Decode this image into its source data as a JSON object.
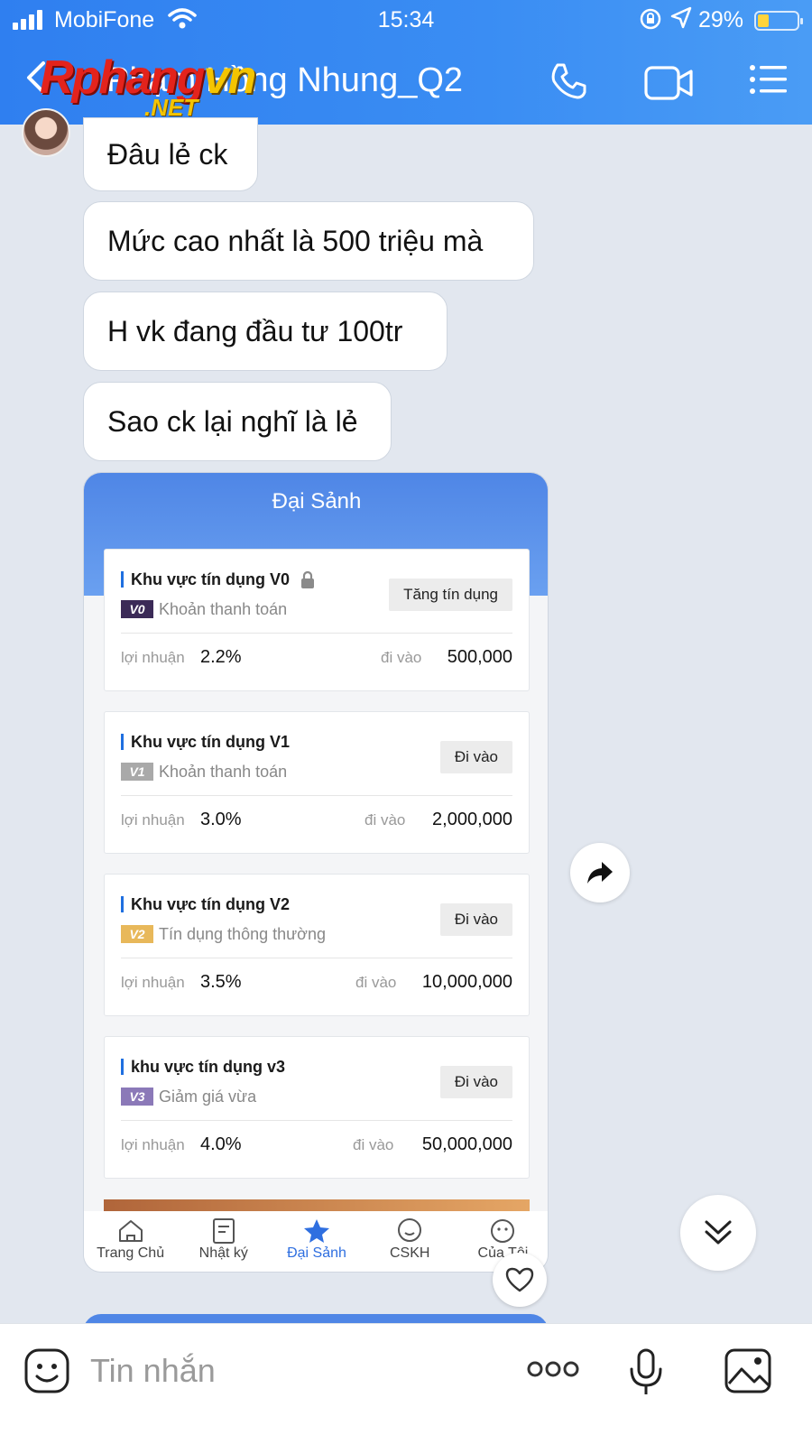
{
  "status_bar": {
    "carrier": "MobiFone",
    "time": "15:34",
    "battery": "29%"
  },
  "header": {
    "back_icon": "chevron-left-icon",
    "title": "Phạm Hồng Nhung_Q2",
    "icons": [
      "phone-icon",
      "video-icon",
      "menu-icon"
    ]
  },
  "watermark": {
    "main_red": "Rphang",
    "main_yellow": "vn",
    "sub": ".NET"
  },
  "messages": [
    {
      "text": "Đâu lẻ ck"
    },
    {
      "text": "Mức cao nhất là 500 triệu mà"
    },
    {
      "text": "H vk đang đầu tư 100tr"
    },
    {
      "text": "Sao ck lại nghĩ là lẻ"
    }
  ],
  "image_card": {
    "title": "Đại Sảnh",
    "zones": [
      {
        "name": "Khu vực tín dụng V0",
        "locked": true,
        "tag": "V0",
        "tag_color": "#3b2a57",
        "desc": "Khoản thanh toán",
        "button": "Tăng tín dụng",
        "profit_label": "lợi nhuận",
        "profit": "2.2%",
        "entry_label": "đi vào",
        "entry": "500,000"
      },
      {
        "name": "Khu vực tín dụng V1",
        "locked": false,
        "tag": "V1",
        "tag_color": "#a9a9a9",
        "desc": "Khoản thanh toán",
        "button": "Đi vào",
        "profit_label": "lợi nhuận",
        "profit": "3.0%",
        "entry_label": "đi vào",
        "entry": "2,000,000"
      },
      {
        "name": "Khu vực tín dụng V2",
        "locked": false,
        "tag": "V2",
        "tag_color": "#e8b85a",
        "desc": "Tín dụng thông thường",
        "button": "Đi vào",
        "profit_label": "lợi nhuận",
        "profit": "3.5%",
        "entry_label": "đi vào",
        "entry": "10,000,000"
      },
      {
        "name": "khu vực tín dụng v3",
        "locked": false,
        "tag": "V3",
        "tag_color": "#8b79b8",
        "desc": "Giảm giá vừa",
        "button": "Đi vào",
        "profit_label": "lợi nhuận",
        "profit": "4.0%",
        "entry_label": "đi vào",
        "entry": "50,000,000"
      }
    ],
    "tabs": [
      {
        "label": "Trang Chủ",
        "icon": "home-icon"
      },
      {
        "label": "Nhật ký",
        "icon": "journal-icon"
      },
      {
        "label": "Đại Sảnh",
        "icon": "star-icon",
        "active": true
      },
      {
        "label": "CSKH",
        "icon": "chat-icon"
      },
      {
        "label": "Của Tôi",
        "icon": "profile-icon"
      }
    ]
  },
  "input_bar": {
    "placeholder": "Tin nhắn",
    "icons": [
      "emoji-icon",
      "more-icon",
      "microphone-icon",
      "gallery-icon"
    ]
  },
  "colors": {
    "header": "#3a8df3",
    "accent": "#2f6fe0",
    "background": "#e2e7ef"
  }
}
